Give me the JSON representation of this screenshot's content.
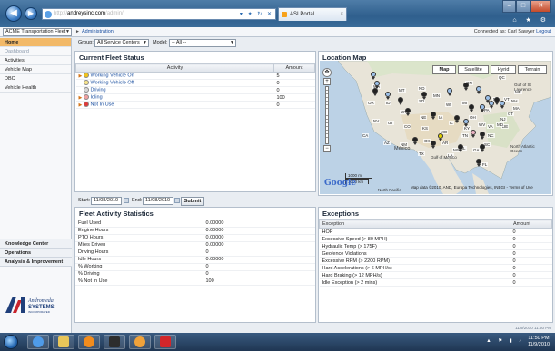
{
  "browser": {
    "address_prefix": "http://",
    "address_host": "andreysinc.com",
    "address_rest": "/admin/",
    "tab_title": "ASI Portal",
    "right_icons": "⌂ ★ ⚙"
  },
  "header": {
    "company": "ACME Transportation Fleet",
    "admin_link": "Administration",
    "connected_label": "Connected as: Carl Sawyer",
    "logout": "Logout"
  },
  "sidebar": {
    "items": [
      {
        "label": "Home"
      },
      {
        "label": "Dashboard"
      },
      {
        "label": "Activities"
      },
      {
        "label": "Vehicle Map"
      },
      {
        "label": "DBC"
      },
      {
        "label": "Vehicle Health"
      }
    ],
    "sections": [
      {
        "label": "Knowledge Center"
      },
      {
        "label": "Operations"
      },
      {
        "label": "Analysis & Improvement"
      }
    ],
    "logo_text_1": "Andromeda",
    "logo_text_2": "SYSTEMS",
    "logo_text_3": "INCORPORATED"
  },
  "filters": {
    "group_label": "Group:",
    "group_value": "All Service Centers",
    "model_label": "Model:",
    "model_value": "-- All --"
  },
  "fleet_status": {
    "title": "Current Fleet Status",
    "col_activity": "Activity",
    "col_amount": "Amount",
    "rows": [
      {
        "label": "Working Vehicle On",
        "amount": "5",
        "color": "#f2c41a",
        "expand": true
      },
      {
        "label": "Working Vehicle Off",
        "amount": "0",
        "color": "#f7e48a",
        "expand": false
      },
      {
        "label": "Driving",
        "amount": "0",
        "color": "#d7d7d7",
        "expand": false
      },
      {
        "label": "Idling",
        "amount": "100",
        "color": "#f0a0a0",
        "expand": true
      },
      {
        "label": "Not In Use",
        "amount": "0",
        "color": "#e03a3a",
        "expand": true
      }
    ]
  },
  "date_range": {
    "start_label": "Start:",
    "start_value": "11/08/2010",
    "end_label": "End:",
    "end_value": "11/08/2010",
    "submit": "Submit"
  },
  "activity_stats": {
    "title": "Fleet Activity Statistics",
    "rows": [
      {
        "label": "Fuel Used",
        "value": "0.00000"
      },
      {
        "label": "Engine Hours",
        "value": "0.00000"
      },
      {
        "label": "PTO Hours",
        "value": "0.00000"
      },
      {
        "label": "Miles Driven",
        "value": "0.00000"
      },
      {
        "label": "Driving Hours",
        "value": "0"
      },
      {
        "label": "Idle Hours",
        "value": "0.00000"
      },
      {
        "label": "% Working",
        "value": "0"
      },
      {
        "label": "% Driving",
        "value": "0"
      },
      {
        "label": "% Not In Use",
        "value": "100"
      }
    ]
  },
  "location_map": {
    "title": "Location Map",
    "buttons": [
      "Map",
      "Satellite",
      "Hyrid",
      "Terrain"
    ],
    "labels": {
      "gulf_mexico": "Gulf of Mexico",
      "mexico": "México",
      "north_atlantic": "North Atlantic Ocean",
      "gulf_st_lawrence": "Gulf of St Lawrence",
      "scale_mi": "1000 mi",
      "scale_km": "1000 km",
      "north_pacific": "North Pacific",
      "google": "Google",
      "map_data": "Map data ©2010, AND, Europa Technologies, INEGI - Terms of Use"
    },
    "states": [
      "WA",
      "MT",
      "ND",
      "MN",
      "OR",
      "ID",
      "SD",
      "WI",
      "MI",
      "NY",
      "WY",
      "NE",
      "IA",
      "IL",
      "PA",
      "NV",
      "UT",
      "CO",
      "KS",
      "MO",
      "OH",
      "VA",
      "CA",
      "AZ",
      "NM",
      "OK",
      "AR",
      "TN",
      "NC",
      "SC",
      "TX",
      "LA",
      "AL",
      "GA",
      "FL",
      "ME",
      "NH",
      "VT",
      "MA",
      "CT",
      "NJ",
      "DE",
      "MD",
      "WV",
      "KY",
      "QC",
      "ON",
      "MS"
    ]
  },
  "exceptions": {
    "title": "Exceptions",
    "col_exception": "Exception",
    "col_amount": "Amount",
    "rows": [
      {
        "label": "HOP",
        "amount": "0"
      },
      {
        "label": "Excessive Speed (> 80 MPH)",
        "amount": "0"
      },
      {
        "label": "Hydraulic Temp (> 175F)",
        "amount": "0"
      },
      {
        "label": "Geofence Violations",
        "amount": "0"
      },
      {
        "label": "Excessive RPM (> 2200 RPM)",
        "amount": "0"
      },
      {
        "label": "Hard Accelerations (> 6 MPH/s)",
        "amount": "0"
      },
      {
        "label": "Hard Braking (> 12 MPH/s)",
        "amount": "0"
      },
      {
        "label": "Idle Exception (> 2 mins)",
        "amount": "0"
      }
    ]
  },
  "footer_stamp": "11/9/2010 11:50 PM",
  "taskbar": {
    "time": "11:50 PM",
    "date": "11/9/2010"
  }
}
